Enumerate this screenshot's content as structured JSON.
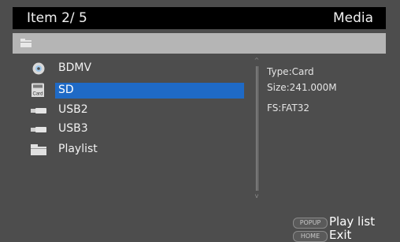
{
  "header": {
    "counter": "Item 2/ 5",
    "title": "Media"
  },
  "pathbar": {
    "icon": "folder-icon"
  },
  "devices": [
    {
      "label": "BDMV",
      "icon": "disc-icon",
      "selected": false
    },
    {
      "label": "SD",
      "icon": "card-icon",
      "selected": true,
      "icon_text": "Card"
    },
    {
      "label": "USB2",
      "icon": "usb-icon",
      "selected": false
    },
    {
      "label": "USB3",
      "icon": "usb-icon",
      "selected": false
    },
    {
      "label": "Playlist",
      "icon": "folder-icon",
      "selected": false
    }
  ],
  "info": {
    "type": "Type:Card",
    "size": "Size:241.000M",
    "fs": "FS:FAT32"
  },
  "hints": {
    "popup_key": "POPUP",
    "popup_action": "Play list",
    "home_key": "HOME",
    "home_action": "Exit"
  },
  "colors": {
    "selection": "#1f6ac6",
    "background": "#4d4d4d",
    "header": "#000000",
    "pathbar": "#b5b5b5"
  }
}
